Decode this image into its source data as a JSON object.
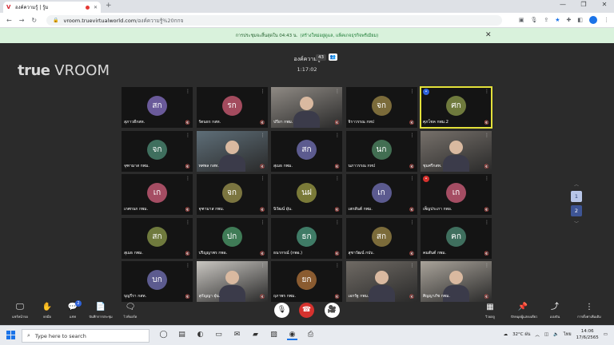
{
  "browser": {
    "tab_title": "องค์ความรู้ | รู้ม",
    "favicon": "V",
    "new_tab": "+",
    "url_host": "vroom.truevirtualworld.com",
    "url_path": "/องค์ความรู้%20กกจ",
    "window_controls": [
      "—",
      "❐",
      "✕"
    ]
  },
  "notice": {
    "text": "การประชุมจะสิ้นสุดใน 04:43 น.",
    "link": "(สร้างใหม่อยู่ดูแล, แพ็คเกจธุรกิจพรีเมียม)",
    "close": "✕"
  },
  "meeting": {
    "logo_main": "true",
    "logo_sub": "VROOM",
    "room_title": "องค์ความรู้",
    "participant_count": "43",
    "participant_icon": "👥",
    "timer": "1:17:02"
  },
  "tiles": [
    {
      "name": "สุภาวดีกสท.",
      "initials": "สก",
      "color": "#6a5a9a",
      "mic": "🔇"
    },
    {
      "name": "รัตนธร กสท.",
      "initials": "รก",
      "color": "#a34b5e",
      "mic": "🔇"
    },
    {
      "name": "ปรียา กพม.",
      "initials": "",
      "video": "#8f8a84",
      "mic": "🔇"
    },
    {
      "name": "จิราวรรณ กทป",
      "initials": "จก",
      "color": "#7b6b3a",
      "mic": "🔇"
    },
    {
      "name": "ศุภโชค กพม.2",
      "initials": "ศก",
      "color": "#6f7a3d",
      "mic": "🔇",
      "active": true,
      "badge": "#2f62d8"
    },
    {
      "name": "จุฑามาส กพม.",
      "initials": "จก",
      "color": "#3f6f5e",
      "mic": "🔇"
    },
    {
      "name": "ทศพล กสท.",
      "initials": "",
      "video": "#5e6e78",
      "mic": "🔇"
    },
    {
      "name": "สุเมธ กพม.",
      "initials": "สก",
      "color": "#5c5b8f",
      "mic": "🔇"
    },
    {
      "name": "นภาวรรณ กทป",
      "initials": "นก",
      "color": "#426e52",
      "mic": "🔇"
    },
    {
      "name": "ชุมศรีกสท.",
      "initials": "",
      "video": "#76706a",
      "mic": "🔇"
    },
    {
      "name": "เกศกนก กพม.",
      "initials": "เก",
      "color": "#a54d63",
      "mic": "🔇"
    },
    {
      "name": "จุฑามาส กพม.",
      "initials": "จก",
      "color": "#7b7540",
      "mic": "🔇"
    },
    {
      "name": "นิวัฒน์ ฝุ่น.",
      "initials": "นฝ",
      "color": "#7a7a38",
      "mic": "🔇"
    },
    {
      "name": "เสกสันต์ กพม.",
      "initials": "เก",
      "color": "#5b5a8f",
      "mic": "🔇"
    },
    {
      "name": "เพ็ญประภา กพอ.",
      "initials": "เก",
      "color": "#a54d63",
      "mic": "🔇",
      "badge": "#d6322e"
    },
    {
      "name": "สุเมธ กพม.",
      "initials": "สก",
      "color": "#6f7a3d",
      "mic": "🔇"
    },
    {
      "name": "ปริญญาพร กพอ.",
      "initials": "ปก",
      "color": "#3f7b56",
      "mic": "🔇"
    },
    {
      "name": "ธนากรณ์ (กพอ.)",
      "initials": "ธก",
      "color": "#3f7b66",
      "mic": "🔇"
    },
    {
      "name": "สุชาวัฒน์ กปบ.",
      "initials": "สก",
      "color": "#7b6b3a",
      "mic": "🔇"
    },
    {
      "name": "คมสันต์ กพม.",
      "initials": "คก",
      "color": "#3f6f5e",
      "mic": "🔇"
    },
    {
      "name": "บุญรีรา กสท.",
      "initials": "บก",
      "color": "#5c5b8f",
      "mic": "🔇"
    },
    {
      "name": "สุกัญญา ฝุ่น.",
      "initials": "",
      "video": "#c9c6c1",
      "mic": "🔇"
    },
    {
      "name": "ฤภาพร กพม.",
      "initials": "ยก",
      "color": "#8a5b30",
      "mic": "🔇"
    },
    {
      "name": "เอกรัฐ กพม.",
      "initials": "",
      "video": "#6f6a64",
      "mic": "🔇"
    },
    {
      "name": "ศิญญาภัช กพม.",
      "initials": "",
      "video": "#a9a39a",
      "mic": "🔇"
    }
  ],
  "pager": {
    "up": "︿",
    "page1": "1",
    "page2": "2",
    "down": "﹀"
  },
  "controls": {
    "share": {
      "icon": "🖵",
      "label": "แชร์หน้าจอ"
    },
    "raise": {
      "icon": "✋",
      "label": "ยกมือ"
    },
    "chat": {
      "icon": "💬",
      "label": "แชท",
      "badge": "2"
    },
    "notes": {
      "icon": "📄",
      "label": "บันทึกการประชุม"
    },
    "subtitle": {
      "icon": "🗨",
      "label": "ไวท์บอร์ด"
    },
    "mic": "🎙",
    "hangup": "☎",
    "camera": "🎥",
    "view": {
      "icon": "▦",
      "label": "วิวผลลู"
    },
    "pin": {
      "icon": "📌",
      "label": "ปักหมุดผู้แสดงเดียว"
    },
    "share_link": {
      "icon": "⤴",
      "label": "แบ่งปัน"
    },
    "more": {
      "icon": "⋮",
      "label": "การตั้งค่าเพิ่มเติม"
    }
  },
  "taskbar": {
    "search_placeholder": "Type here to search",
    "weather": "32°C ฝน",
    "lang": "ไทย",
    "time": "14:06",
    "date": "17/6/2565"
  }
}
